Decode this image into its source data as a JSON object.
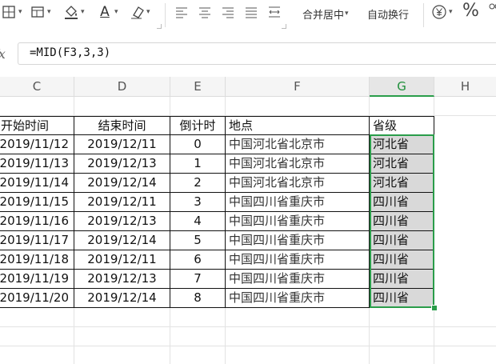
{
  "toolbar": {
    "merge_center_label": "合并居中",
    "wrap_text_label": "自动换行",
    "percent_symbol": "%",
    "icons": [
      "borders-icon",
      "cell-style-icon",
      "fill-color-icon",
      "font-color-icon",
      "clear-format-icon",
      "align-left-icon",
      "align-center-icon",
      "align-right-icon",
      "justify-icon",
      "distributed-icon",
      "currency-icon",
      "percent-icon"
    ],
    "font_color_letter": "A"
  },
  "formula_bar": {
    "fx_label": "fx",
    "formula": "=MID(F3,3,3)"
  },
  "columns": [
    "C",
    "D",
    "E",
    "F",
    "G",
    "H"
  ],
  "selected_column": "G",
  "table": {
    "headers": [
      "开始时间",
      "结束时间",
      "倒计时",
      "地点",
      "省级"
    ],
    "rows": [
      [
        "2019/11/12",
        "2019/12/11",
        "0",
        "中国河北省北京市",
        "河北省"
      ],
      [
        "2019/11/13",
        "2019/12/13",
        "1",
        "中国河北省北京市",
        "河北省"
      ],
      [
        "2019/11/14",
        "2019/12/14",
        "2",
        "中国河北省北京市",
        "河北省"
      ],
      [
        "2019/11/15",
        "2019/12/11",
        "3",
        "中国四川省重庆市",
        "四川省"
      ],
      [
        "2019/11/16",
        "2019/12/13",
        "4",
        "中国四川省重庆市",
        "四川省"
      ],
      [
        "2019/11/17",
        "2019/12/14",
        "5",
        "中国四川省重庆市",
        "四川省"
      ],
      [
        "2019/11/18",
        "2019/12/11",
        "6",
        "中国四川省重庆市",
        "四川省"
      ],
      [
        "2019/11/19",
        "2019/12/13",
        "7",
        "中国四川省重庆市",
        "四川省"
      ],
      [
        "2019/11/20",
        "2019/12/14",
        "8",
        "中国四川省重庆市",
        "四川省"
      ]
    ]
  },
  "colors": {
    "selection": "#2a9d4a",
    "selected_fill": "#d9d9d9"
  }
}
